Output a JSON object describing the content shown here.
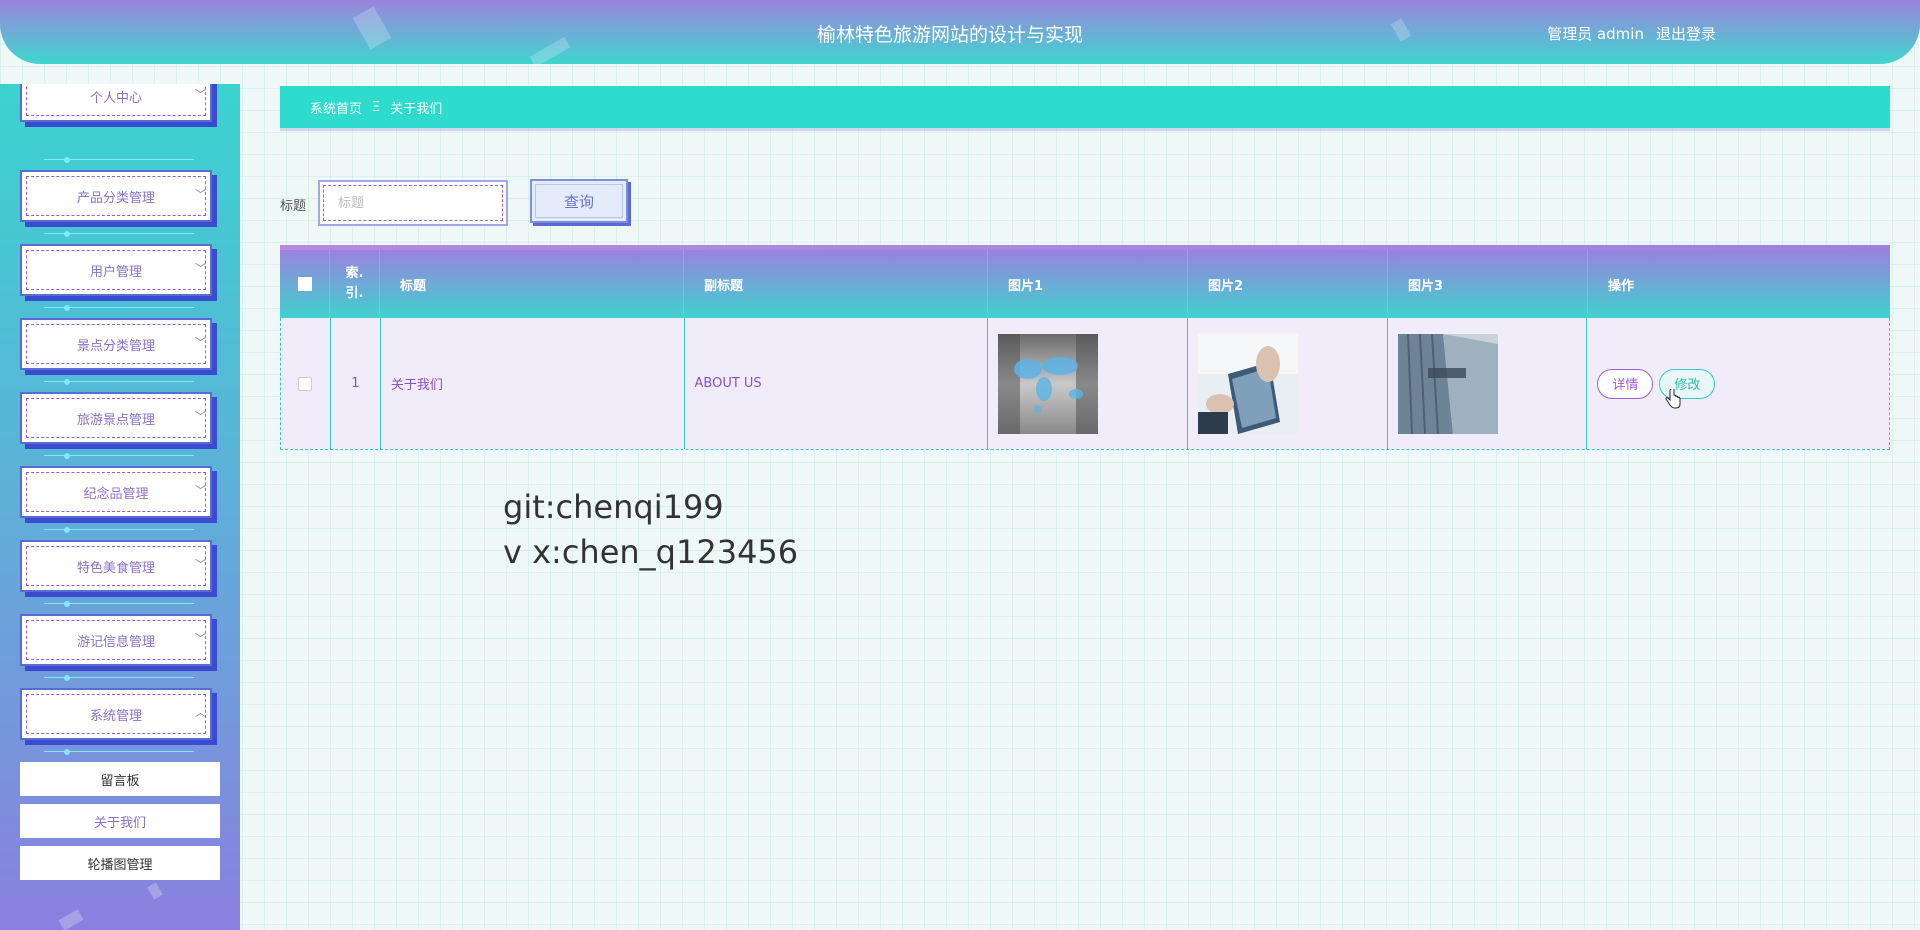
{
  "header": {
    "title": "榆林特色旅游网站的设计与实现",
    "user_label": "管理员 admin",
    "logout_label": "退出登录"
  },
  "sidebar": {
    "menus": [
      {
        "label": "个人中心",
        "chevron": "﹀"
      },
      {
        "label": "产品分类管理",
        "chevron": "﹀"
      },
      {
        "label": "用户管理",
        "chevron": "﹀"
      },
      {
        "label": "景点分类管理",
        "chevron": "﹀"
      },
      {
        "label": "旅游景点管理",
        "chevron": "﹀"
      },
      {
        "label": "纪念品管理",
        "chevron": "﹀"
      },
      {
        "label": "特色美食管理",
        "chevron": "﹀"
      },
      {
        "label": "游记信息管理",
        "chevron": "﹀"
      },
      {
        "label": "系统管理",
        "chevron": "︿"
      }
    ],
    "sub_items": [
      {
        "label": "留言板"
      },
      {
        "label": "关于我们"
      },
      {
        "label": "轮播图管理"
      }
    ]
  },
  "breadcrumb": {
    "home": "系统首页",
    "separator": "Ξ",
    "current": "关于我们"
  },
  "search": {
    "label": "标题",
    "placeholder": "标题",
    "button_label": "查询"
  },
  "table": {
    "headers": {
      "index_line1": "索.",
      "index_line2": "引.",
      "title": "标题",
      "subtitle": "副标题",
      "image1": "图片1",
      "image2": "图片2",
      "image3": "图片3",
      "actions": "操作"
    },
    "rows": [
      {
        "index": "1",
        "title": "关于我们",
        "subtitle": "ABOUT US",
        "detail_label": "详情",
        "edit_label": "修改"
      }
    ]
  },
  "watermark": {
    "line1": "git:chenqi199",
    "line2": "v x:chen_q123456"
  },
  "colors": {
    "accent_teal": "#2ddccc",
    "accent_purple": "#9b84dd",
    "menu_text": "#8a70c8"
  }
}
